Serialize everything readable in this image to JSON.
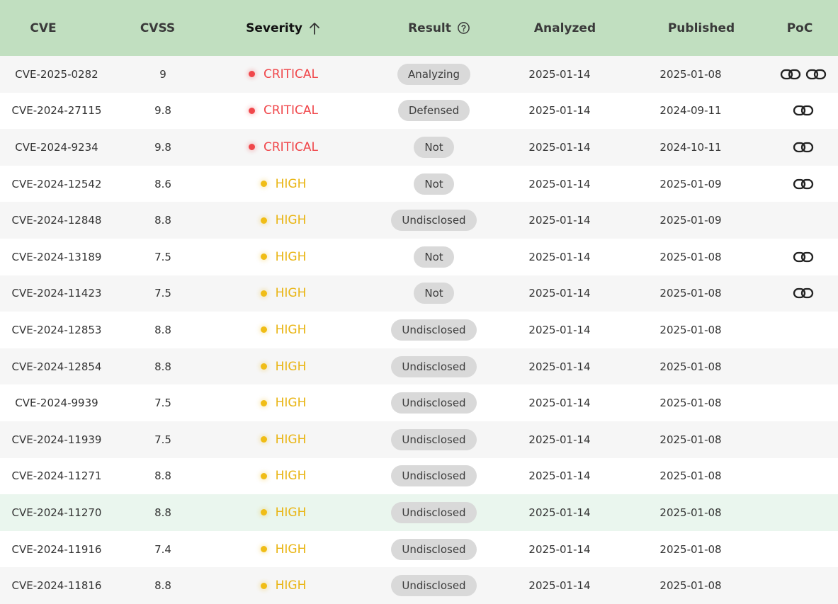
{
  "headers": {
    "cve": "CVE",
    "cvss": "CVSS",
    "severity": "Severity",
    "result": "Result",
    "analyzed": "Analyzed",
    "published": "Published",
    "poc": "PoC"
  },
  "colors": {
    "header_bg": "#c1dfc0",
    "critical": "#f0474b",
    "high": "#e9b514",
    "pill_bg": "#d9d9d9",
    "row_alt": "#f6f6f6",
    "row_highlight": "#eaf6ee"
  },
  "icons": {
    "sort": "arrow-up-icon",
    "help": "question-circle-icon",
    "poc": "link-icon"
  },
  "rows": [
    {
      "cve": "CVE-2025-0282",
      "cvss": "9",
      "severity": "CRITICAL",
      "result": "Analyzing",
      "analyzed": "2025-01-14",
      "published": "2025-01-08",
      "poc_links": 2
    },
    {
      "cve": "CVE-2024-27115",
      "cvss": "9.8",
      "severity": "CRITICAL",
      "result": "Defensed",
      "analyzed": "2025-01-14",
      "published": "2024-09-11",
      "poc_links": 1
    },
    {
      "cve": "CVE-2024-9234",
      "cvss": "9.8",
      "severity": "CRITICAL",
      "result": "Not",
      "analyzed": "2025-01-14",
      "published": "2024-10-11",
      "poc_links": 1
    },
    {
      "cve": "CVE-2024-12542",
      "cvss": "8.6",
      "severity": "HIGH",
      "result": "Not",
      "analyzed": "2025-01-14",
      "published": "2025-01-09",
      "poc_links": 1
    },
    {
      "cve": "CVE-2024-12848",
      "cvss": "8.8",
      "severity": "HIGH",
      "result": "Undisclosed",
      "analyzed": "2025-01-14",
      "published": "2025-01-09",
      "poc_links": 0
    },
    {
      "cve": "CVE-2024-13189",
      "cvss": "7.5",
      "severity": "HIGH",
      "result": "Not",
      "analyzed": "2025-01-14",
      "published": "2025-01-08",
      "poc_links": 1
    },
    {
      "cve": "CVE-2024-11423",
      "cvss": "7.5",
      "severity": "HIGH",
      "result": "Not",
      "analyzed": "2025-01-14",
      "published": "2025-01-08",
      "poc_links": 1
    },
    {
      "cve": "CVE-2024-12853",
      "cvss": "8.8",
      "severity": "HIGH",
      "result": "Undisclosed",
      "analyzed": "2025-01-14",
      "published": "2025-01-08",
      "poc_links": 0
    },
    {
      "cve": "CVE-2024-12854",
      "cvss": "8.8",
      "severity": "HIGH",
      "result": "Undisclosed",
      "analyzed": "2025-01-14",
      "published": "2025-01-08",
      "poc_links": 0
    },
    {
      "cve": "CVE-2024-9939",
      "cvss": "7.5",
      "severity": "HIGH",
      "result": "Undisclosed",
      "analyzed": "2025-01-14",
      "published": "2025-01-08",
      "poc_links": 0
    },
    {
      "cve": "CVE-2024-11939",
      "cvss": "7.5",
      "severity": "HIGH",
      "result": "Undisclosed",
      "analyzed": "2025-01-14",
      "published": "2025-01-08",
      "poc_links": 0
    },
    {
      "cve": "CVE-2024-11271",
      "cvss": "8.8",
      "severity": "HIGH",
      "result": "Undisclosed",
      "analyzed": "2025-01-14",
      "published": "2025-01-08",
      "poc_links": 0
    },
    {
      "cve": "CVE-2024-11270",
      "cvss": "8.8",
      "severity": "HIGH",
      "result": "Undisclosed",
      "analyzed": "2025-01-14",
      "published": "2025-01-08",
      "poc_links": 0,
      "highlighted": true
    },
    {
      "cve": "CVE-2024-11916",
      "cvss": "7.4",
      "severity": "HIGH",
      "result": "Undisclosed",
      "analyzed": "2025-01-14",
      "published": "2025-01-08",
      "poc_links": 0
    },
    {
      "cve": "CVE-2024-11816",
      "cvss": "8.8",
      "severity": "HIGH",
      "result": "Undisclosed",
      "analyzed": "2025-01-14",
      "published": "2025-01-08",
      "poc_links": 0
    }
  ]
}
